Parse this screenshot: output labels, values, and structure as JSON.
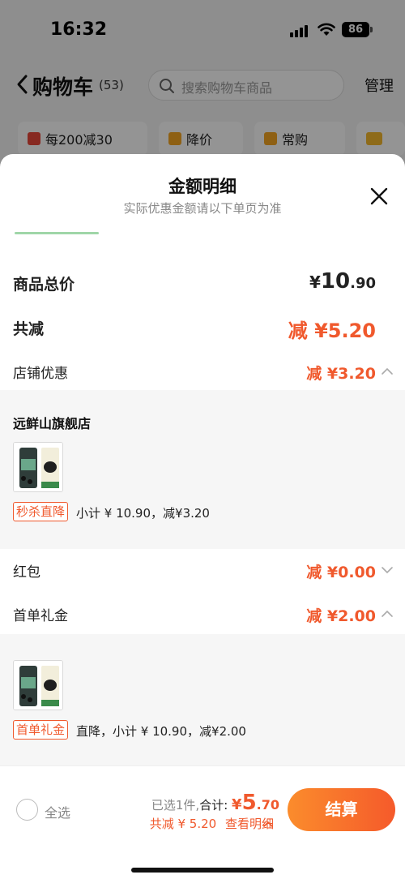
{
  "status_bar": {
    "time": "16:32",
    "battery": "86"
  },
  "nav": {
    "title": "购物车",
    "count": "(53)",
    "search_placeholder": "搜索购物车商品",
    "manage": "管理"
  },
  "chips": [
    {
      "label": "每200减30",
      "icon": "gift-icon"
    },
    {
      "label": "降价",
      "icon": "price-down-icon"
    },
    {
      "label": "常购",
      "icon": "cart-icon"
    },
    {
      "label": "",
      "icon": "folder-icon"
    }
  ],
  "sheet": {
    "title": "金额明细",
    "subtitle": "实际优惠金额请以下单页为准",
    "total_label": "商品总价",
    "total_currency": "¥",
    "total_int": "10",
    "total_dec": ".90",
    "discount_label": "共减",
    "discount_value": "减 ¥5.20",
    "store_discount": {
      "label": "店铺优惠",
      "value": "减 ¥3.20"
    },
    "store_panel": {
      "store_name": "远鲜山旗舰店",
      "tag": "秒杀直降",
      "text": "小计 ¥ 10.90，减¥3.20"
    },
    "red_packet": {
      "label": "红包",
      "value": "减 ¥0.00"
    },
    "first_order": {
      "label": "首单礼金",
      "value": "减 ¥2.00"
    },
    "first_panel": {
      "tag": "首单礼金",
      "text": "直降，小计 ¥ 10.90，减¥2.00"
    }
  },
  "bottom": {
    "select_all": "全选",
    "selected_count": "已选1件,",
    "sum_label": "合计:",
    "sum_currency": "¥",
    "sum_int": "5",
    "sum_dec": ".70",
    "discount_text": "共减 ¥ 5.20",
    "details_link": "查看明细",
    "checkout": "结算"
  },
  "colors": {
    "accent": "#f0592d",
    "button_start": "#fb8c2c",
    "button_end": "#f55a2b"
  }
}
